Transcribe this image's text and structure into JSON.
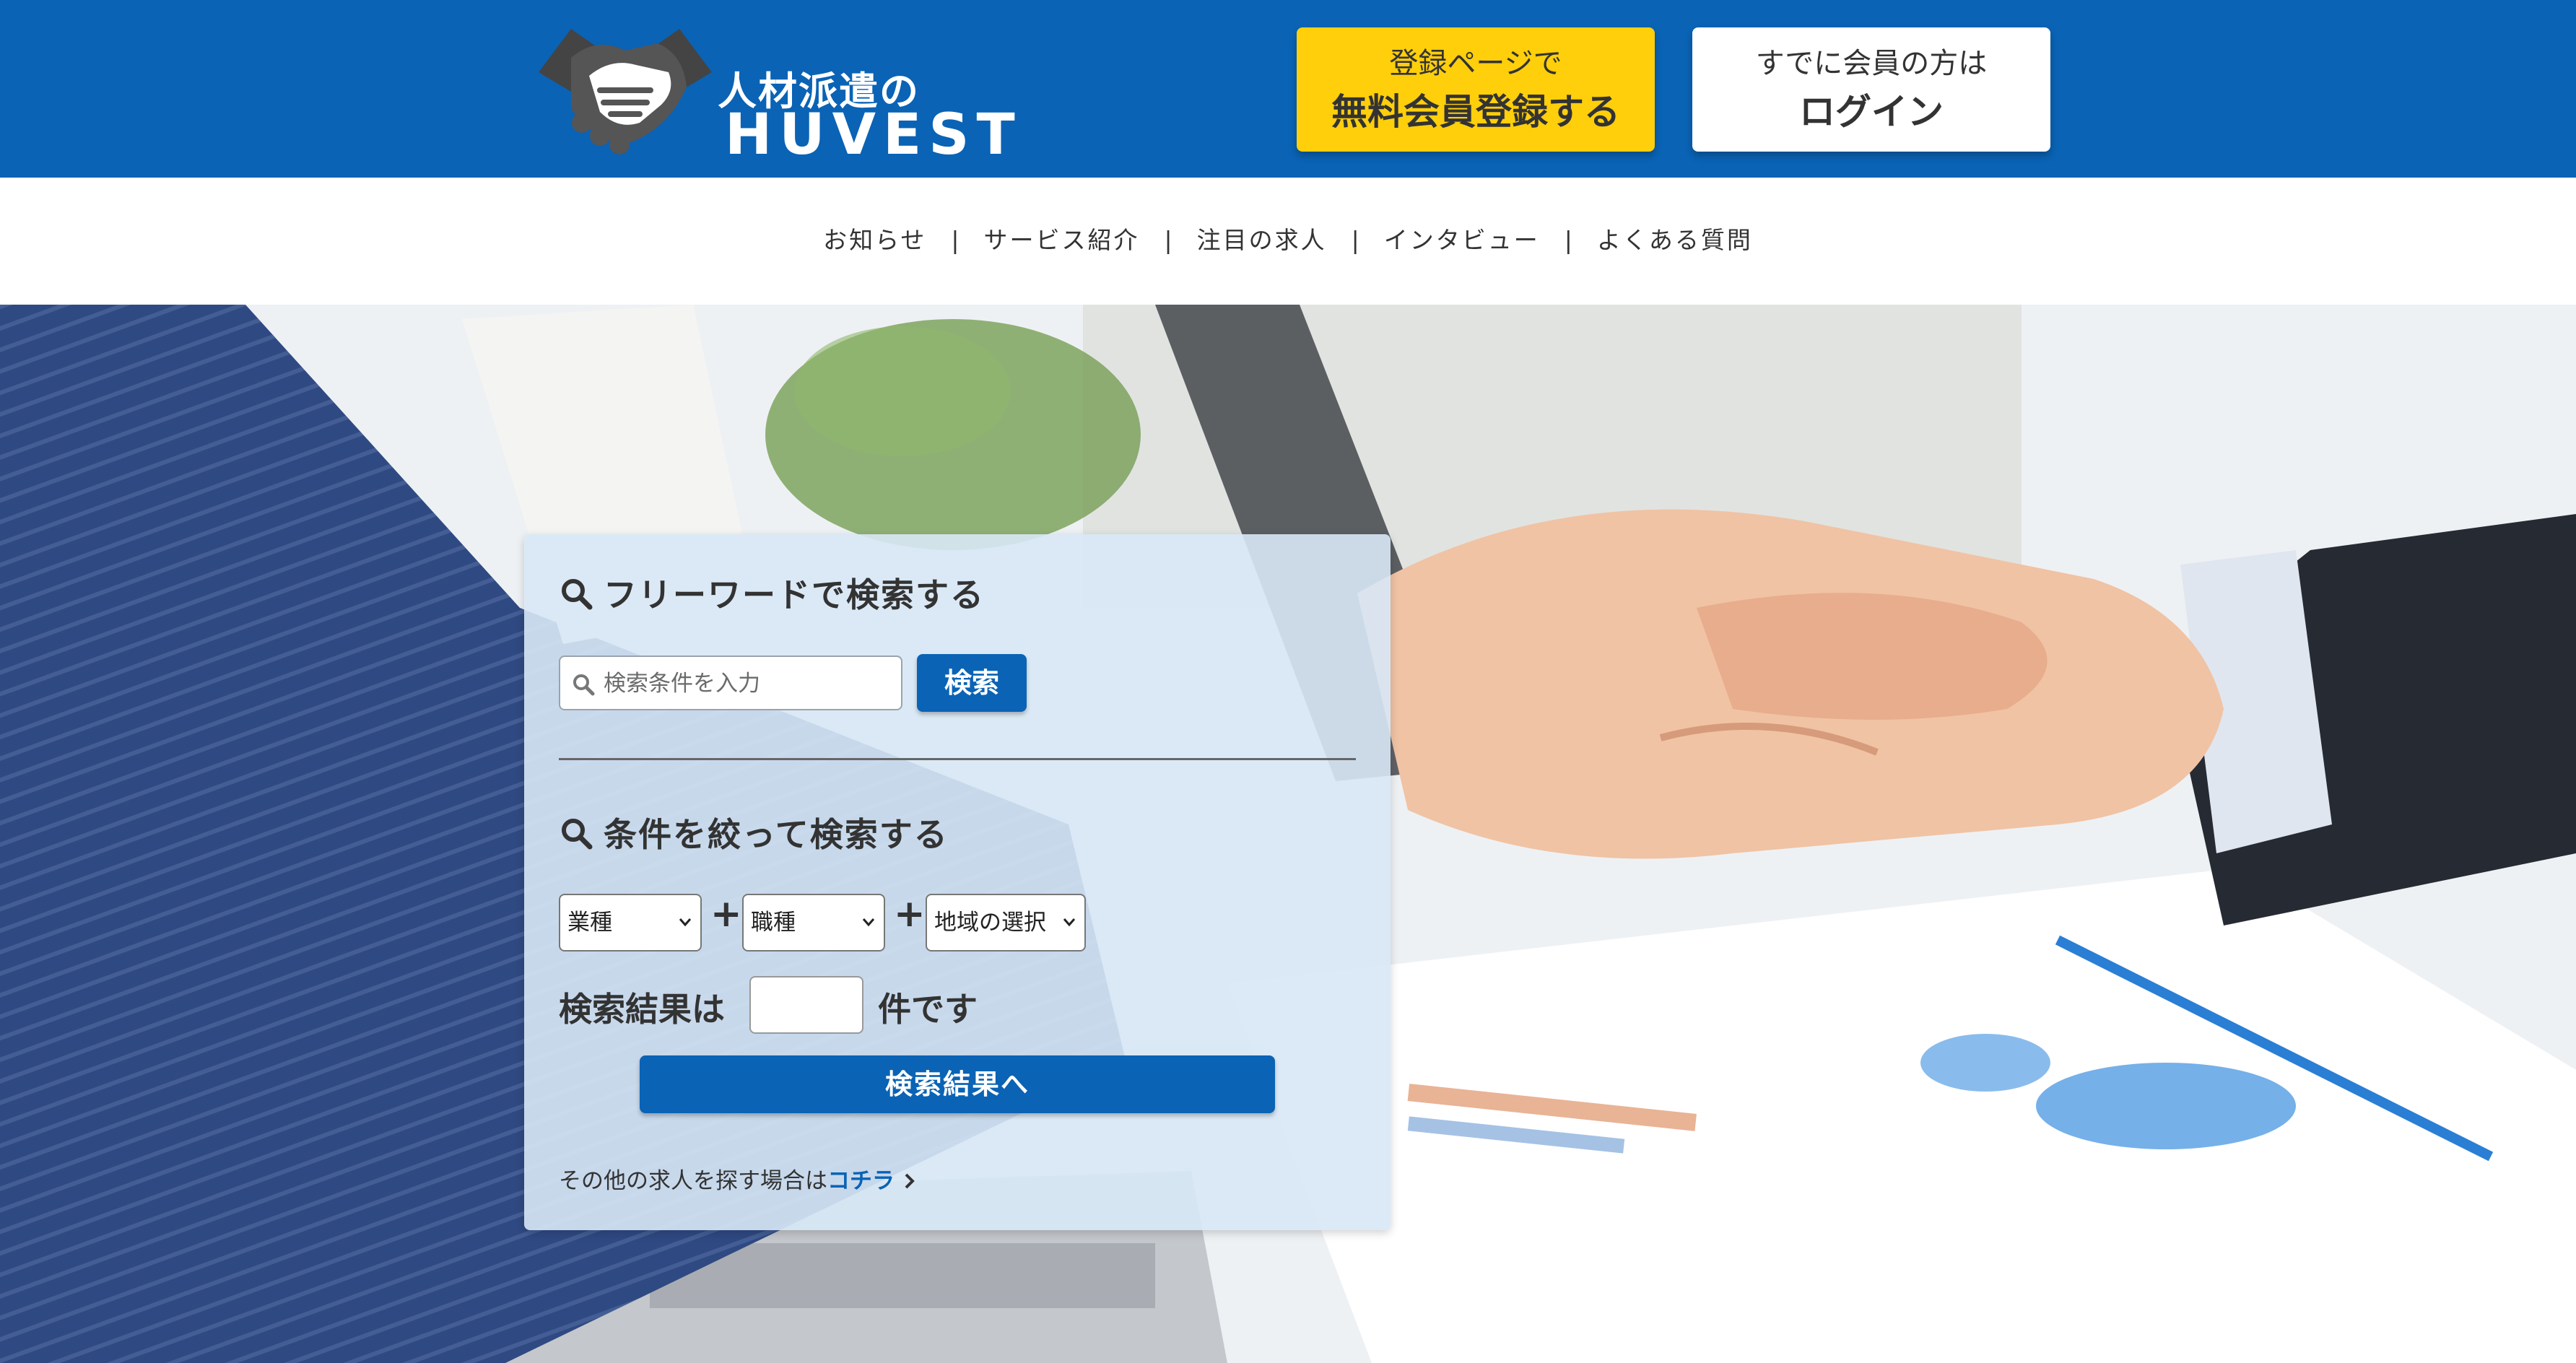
{
  "header": {
    "logo": {
      "sub": "人材派遣の",
      "main": "HUVEST"
    },
    "register_button": {
      "small": "登録ページで",
      "big": "無料会員登録する"
    },
    "login_button": {
      "small": "すでに会員の方は",
      "big": "ログイン"
    }
  },
  "nav": {
    "items": [
      "お知らせ",
      "サービス紹介",
      "注目の求人",
      "インタビュー",
      "よくある質問"
    ],
    "separator": "|"
  },
  "search": {
    "free_word_title": "フリーワードで検索する",
    "free_word_placeholder": "検索条件を入力",
    "search_button": "検索",
    "filter_title": "条件を絞って検索する",
    "selects": {
      "industry": "業種",
      "job_type": "職種",
      "region": "地域の選択"
    },
    "plus": "+",
    "result_prefix": "検索結果は",
    "result_suffix": "件です",
    "result_count": "",
    "results_button": "検索結果へ",
    "other_prefix": "その他の求人を探す場合は",
    "other_link": "コチラ"
  },
  "colors": {
    "brand_blue": "#0a63b5",
    "register_yellow": "#fecf0a",
    "text": "#333333"
  },
  "icons": {
    "search": "magnifier-icon",
    "chevron": "chevron-down-icon",
    "arrow": "chevron-right-icon",
    "logo": "handshake-icon"
  }
}
